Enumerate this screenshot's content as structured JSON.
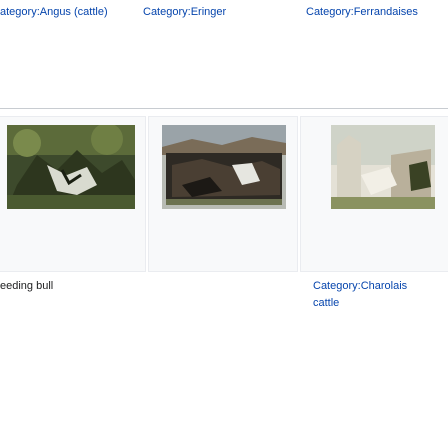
{
  "categories": [
    {
      "label": "ategory:Angus (cattle)"
    },
    {
      "label": "Category:Eringer"
    },
    {
      "label": "Category:Ferrandaises"
    }
  ],
  "gallery": [
    {
      "caption": "eeding bull"
    },
    {
      "caption": ""
    },
    {
      "caption": "Category:Charolais cattle"
    }
  ],
  "colors": {
    "link": "#0645ad",
    "divider": "#c8ccd1",
    "gallery_bg": "#f8f9fa"
  }
}
